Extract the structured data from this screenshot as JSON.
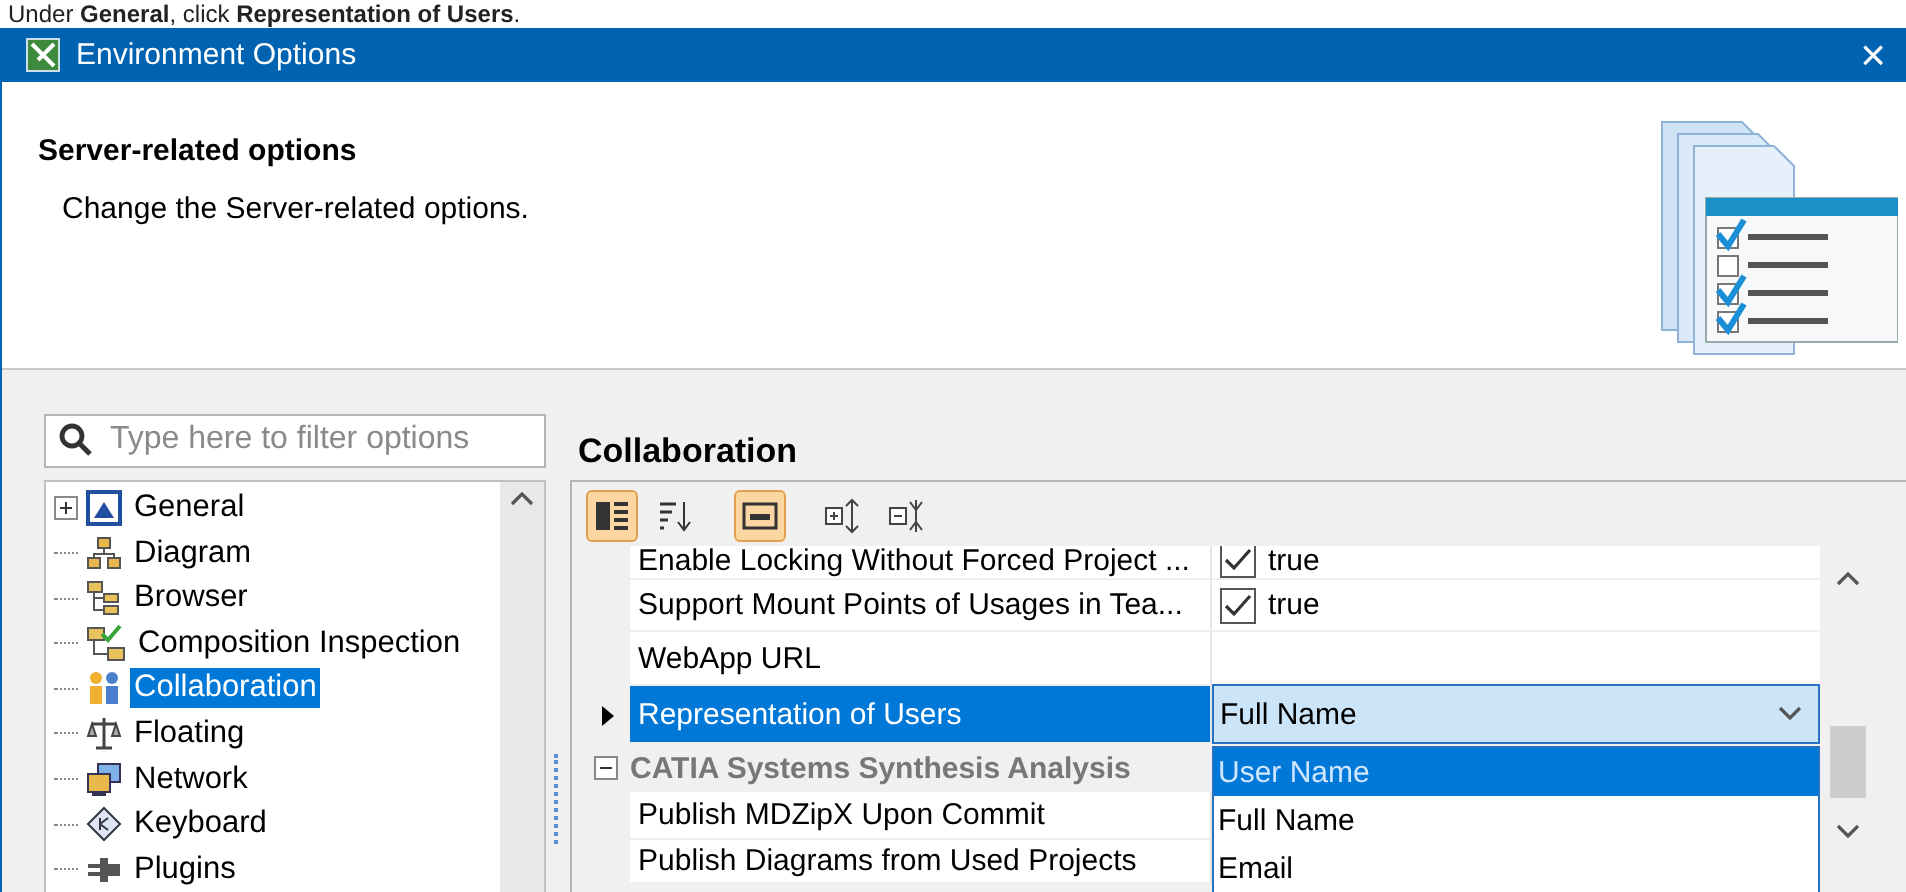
{
  "caption": "Under **General**, click **Representation of Users**.",
  "window": {
    "title": "Environment Options",
    "close": "×"
  },
  "header": {
    "title": "Server-related options",
    "description": "Change the Server-related options."
  },
  "filter": {
    "placeholder": "Type here to filter options"
  },
  "tree": [
    {
      "label": "General",
      "kind": "branch",
      "expanded": false,
      "selected": false
    },
    {
      "label": "Diagram",
      "kind": "leaf",
      "selected": false
    },
    {
      "label": "Browser",
      "kind": "leaf",
      "selected": false
    },
    {
      "label": "Composition Inspection",
      "kind": "leaf",
      "selected": false
    },
    {
      "label": "Collaboration",
      "kind": "leaf",
      "selected": true
    },
    {
      "label": "Floating",
      "kind": "leaf",
      "selected": false
    },
    {
      "label": "Network",
      "kind": "leaf",
      "selected": false
    },
    {
      "label": "Keyboard",
      "kind": "leaf",
      "selected": false
    },
    {
      "label": "Plugins",
      "kind": "leaf",
      "selected": false
    }
  ],
  "panel": {
    "title": "Collaboration"
  },
  "toolbar": [
    {
      "kind": "categorized",
      "selected": true
    },
    {
      "kind": "sort",
      "selected": false
    },
    {
      "kind": "description",
      "selected": true
    },
    {
      "kind": "expand",
      "selected": false
    },
    {
      "kind": "collapse",
      "selected": false
    }
  ],
  "properties": [
    {
      "kind": "checkbox",
      "name": "Enable Locking Without Forced Project ...",
      "value": "true",
      "checked": true,
      "selected": false
    },
    {
      "kind": "checkbox",
      "name": "Support Mount Points of Usages in Tea...",
      "value": "true",
      "checked": true,
      "selected": false
    },
    {
      "kind": "text",
      "name": "WebApp URL",
      "selected": false
    },
    {
      "kind": "dropdown",
      "name": "Representation of Users",
      "value": "Full Name",
      "selected": true
    },
    {
      "kind": "group",
      "name": "CATIA Systems Synthesis Analysis",
      "expanded": true
    },
    {
      "kind": "text",
      "name": "Publish MDZipX Upon Commit",
      "selected": false
    },
    {
      "kind": "text",
      "name": "Publish Diagrams from Used Projects",
      "selected": false
    }
  ],
  "dropdown_options": [
    {
      "label": "User Name",
      "selected": true
    },
    {
      "label": "Full Name",
      "selected": false
    },
    {
      "label": "Email",
      "selected": false
    }
  ]
}
